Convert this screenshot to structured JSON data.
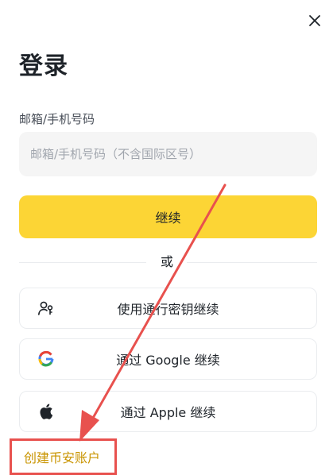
{
  "header": {
    "close_icon": "close-icon",
    "title": "登录"
  },
  "form": {
    "field_label": "邮箱/手机号码",
    "input_placeholder": "邮箱/手机号码（不含国际区号）",
    "input_value": "",
    "continue_label": "继续"
  },
  "divider": {
    "text": "或"
  },
  "alt_options": [
    {
      "icon": "passkey-icon",
      "label": "使用通行密钥继续"
    },
    {
      "icon": "google-icon",
      "label": "通过 Google 继续"
    },
    {
      "icon": "apple-icon",
      "label": "通过 Apple 继续"
    }
  ],
  "footer": {
    "create_account_label": "创建币安账户"
  },
  "annotation": {
    "color": "#e8514e",
    "arrow": "arrow-annotation",
    "highlight": "highlight-box"
  },
  "colors": {
    "accent": "#fcd535",
    "link": "#c99400",
    "text": "#1e2329",
    "input_bg": "#f5f5f5",
    "border": "#eaecef"
  }
}
